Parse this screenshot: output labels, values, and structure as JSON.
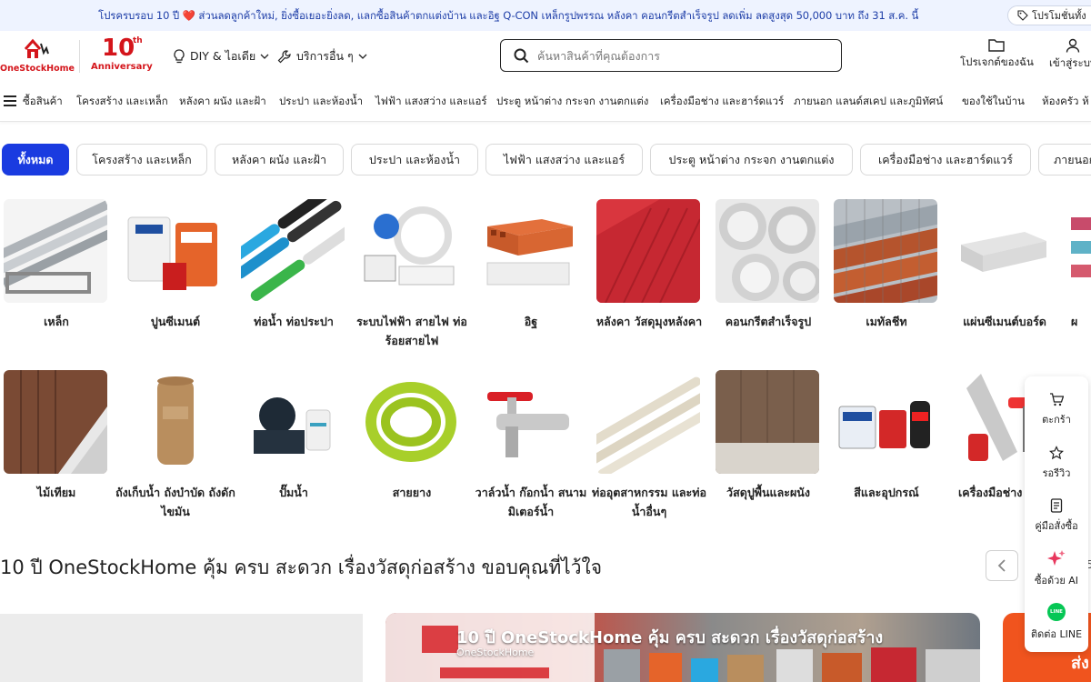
{
  "announcement": {
    "text_before": "โปรครบรอบ 10 ปี",
    "text_after": "ส่วนลดลูกค้าใหม่, ยิ่งซื้อเยอะยิ่งลด, แลกซื้อสินค้าตกแต่งบ้าน และอิฐ Q-CON เหล็กรูปพรรณ หลังคา คอนกรีตสำเร็จรูป ลดเพิ่ม ลดสูงสุด 50,000 บาท ถึง 31 ส.ค. นี้",
    "promo_button": "โปรโมชั่นทั้ง"
  },
  "header": {
    "logo_text": "OneStockHome",
    "anniversary_number": "10",
    "anniversary_suffix": "th",
    "anniversary_word": "Anniversary",
    "nav_diy": "DIY & ไอเดีย",
    "nav_services": "บริการอื่น ๆ",
    "search_placeholder": "ค้นหาสินค้าที่คุณต้องการ",
    "projects_label": "โปรเจกต์ของฉัน",
    "login_label": "เข้าสู่ระบบ"
  },
  "category_menu": {
    "all_label": "ซื้อสินค้า",
    "items": [
      "โครงสร้าง และเหล็ก",
      "หลังคา ผนัง และฝ้า",
      "ประปา และห้องน้ำ",
      "ไฟฟ้า แสงสว่าง และแอร์",
      "ประตู หน้าต่าง กระจก งานตกแต่ง",
      "เครื่องมือช่าง และฮาร์ดแวร์",
      "ภายนอก แลนด์สเคป และภูมิทัศน์",
      "ของใช้ในบ้าน",
      "ห้องครัว ห้"
    ]
  },
  "filter_chips": [
    "ทั้งหมด",
    "โครงสร้าง และเหล็ก",
    "หลังคา ผนัง และฝ้า",
    "ประปา และห้องน้ำ",
    "ไฟฟ้า แสงสว่าง และแอร์",
    "ประตู หน้าต่าง กระจก งานตกแต่ง",
    "เครื่องมือช่าง และฮาร์ดแวร์",
    "ภายนอก"
  ],
  "categories_row1": [
    {
      "label": "เหล็ก",
      "icon": "steel-pipes"
    },
    {
      "label": "ปูนซีเมนต์",
      "icon": "cement-bags"
    },
    {
      "label": "ท่อน้ำ ท่อประปา",
      "icon": "water-pipes"
    },
    {
      "label": "ระบบไฟฟ้า สายไฟ ท่อร้อยสายไฟ",
      "icon": "electrical-wiring"
    },
    {
      "label": "อิฐ",
      "icon": "bricks"
    },
    {
      "label": "หลังคา วัสดุมุงหลังคา",
      "icon": "roof-sheet"
    },
    {
      "label": "คอนกรีตสำเร็จรูป",
      "icon": "concrete-pipes"
    },
    {
      "label": "เมทัลชีท",
      "icon": "metal-sheet"
    },
    {
      "label": "แผ่นซีเมนต์บอร์ด",
      "icon": "cement-board"
    },
    {
      "label": "ผ",
      "icon": "partial"
    }
  ],
  "categories_row2": [
    {
      "label": "ไม้เทียม",
      "icon": "synthetic-wood"
    },
    {
      "label": "ถังเก็บน้ำ ถังบำบัด ถังดักไขมัน",
      "icon": "water-tank"
    },
    {
      "label": "ปั๊มน้ำ",
      "icon": "water-pump"
    },
    {
      "label": "สายยาง",
      "icon": "garden-hose"
    },
    {
      "label": "วาล์วน้ำ ก๊อกน้ำ สนาม มิเตอร์น้ำ",
      "icon": "water-valve"
    },
    {
      "label": "ท่ออุตสาหกรรม และท่อน้ำอื่นๆ",
      "icon": "industrial-pipes"
    },
    {
      "label": "วัสดุปูพื้นและผนัง",
      "icon": "flooring"
    },
    {
      "label": "สีและอุปกรณ์",
      "icon": "paint"
    },
    {
      "label": "เครื่องมือช่าง ฮาร์ดแวร์",
      "icon": "tools"
    }
  ],
  "section": {
    "title": "10 ปี OneStockHome คุ้ม ครบ สะดวก เรื่องวัสดุก่อสร้าง ขอบคุณที่ไว้ใจ",
    "count_fragment": "5"
  },
  "banners": {
    "video_title": "10 ปี OneStockHome คุ้ม ครบ สะดวก เรื่องวัสดุก่อสร้าง",
    "video_sub": "OneStockHome",
    "right_text": "ส่ง"
  },
  "floating_panel": {
    "cart": "ตะกร้า",
    "review": "รอรีวิว",
    "guide": "คู่มือสั่งซื้อ",
    "ai": "ซื้อด้วย AI",
    "line_badge": "LINE",
    "line": "ติดต่อ LINE"
  },
  "colors": {
    "brand_red": "#d4151b",
    "accent_blue": "#1a3be0",
    "line_green": "#06c755"
  }
}
